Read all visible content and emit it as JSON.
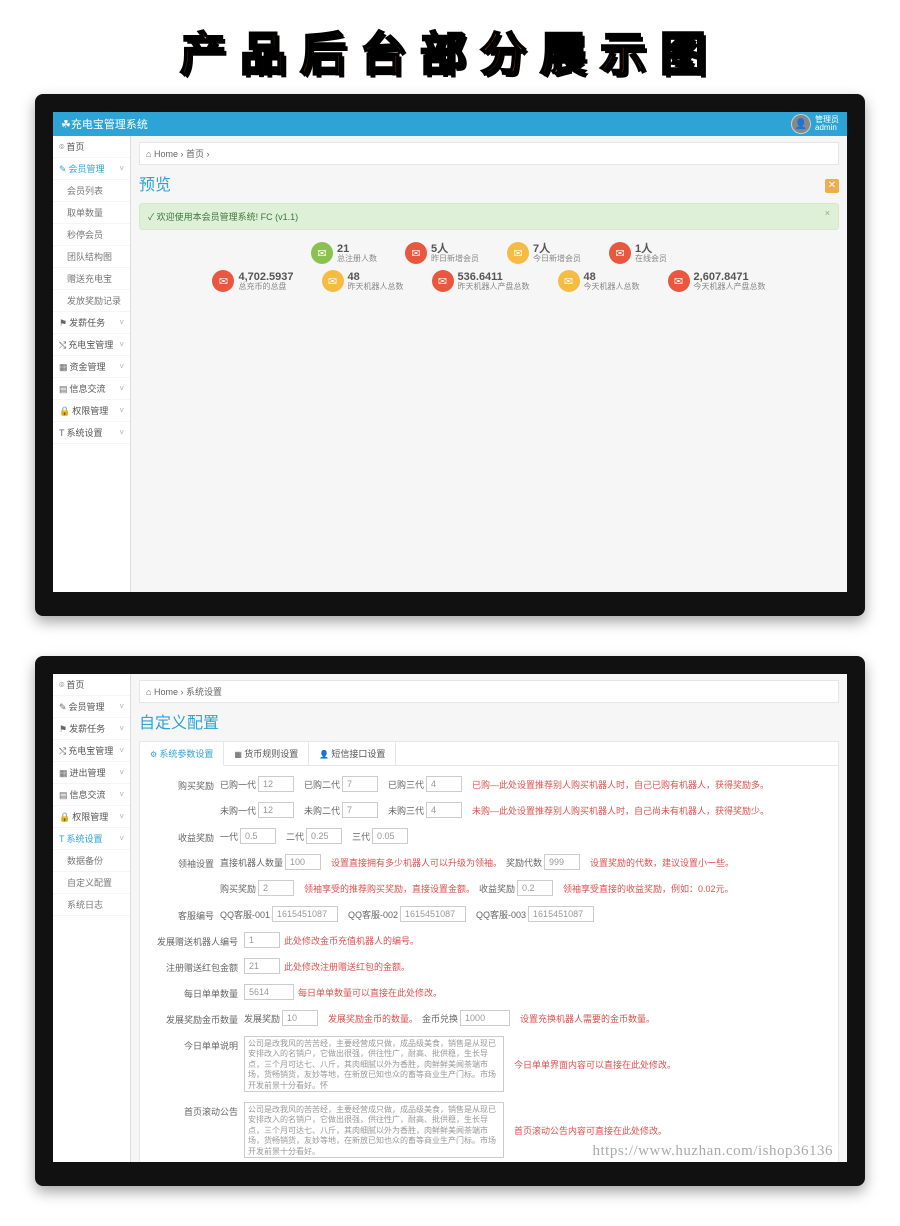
{
  "banner": "产品后台部分展示图",
  "app_title": "充电宝管理系统",
  "user": {
    "role": "管理员",
    "name": "admin"
  },
  "screen1": {
    "breadcrumb": [
      "Home",
      "首页"
    ],
    "title": "预览",
    "alert": "欢迎使用本会员管理系统! FC (v1.1)",
    "sidebar": {
      "top": "首页",
      "group1": {
        "label": "会员管理",
        "items": [
          "会员列表",
          "取单数量",
          "秒停会员",
          "团队结构图",
          "赠送充电宝",
          "发放奖励记录"
        ]
      },
      "rest": [
        "发薪任务",
        "充电宝管理",
        "资金管理",
        "信息交流",
        "权限管理",
        "系统设置"
      ]
    },
    "stats_top": [
      {
        "value": "21",
        "label": "总注册人数",
        "color": "green"
      },
      {
        "value": "5人",
        "label": "昨日新增会员",
        "color": "red"
      },
      {
        "value": "7人",
        "label": "今日新增会员",
        "color": "orange"
      },
      {
        "value": "1人",
        "label": "在线会员",
        "color": "red"
      }
    ],
    "stats_bot": [
      {
        "value": "4,702.5937",
        "label": "总充币的总盘",
        "color": "red"
      },
      {
        "value": "48",
        "label": "昨天机器人总数",
        "color": "orange"
      },
      {
        "value": "536.6411",
        "label": "昨天机器人产盘总数",
        "color": "red"
      },
      {
        "value": "48",
        "label": "今天机器人总数",
        "color": "orange"
      },
      {
        "value": "2,607.8471",
        "label": "今天机器人产盘总数",
        "color": "red"
      }
    ]
  },
  "screen2": {
    "breadcrumb": [
      "Home",
      "系统设置"
    ],
    "title": "自定义配置",
    "sidebar": {
      "top": "首页",
      "items": [
        "会员管理",
        "发薪任务",
        "充电宝管理",
        "进出管理",
        "信息交流",
        "权限管理"
      ],
      "group": {
        "label": "系统设置",
        "items": [
          "数据备份",
          "自定义配置",
          "系统日志"
        ]
      }
    },
    "tabs": [
      "系统参数设置",
      "货币规则设置",
      "短信接口设置"
    ],
    "form": {
      "buy_bonus": {
        "label": "购买奖励",
        "row1": {
          "f1l": "已购一代",
          "f1v": "12",
          "f2l": "已购二代",
          "f2v": "7",
          "f3l": "已购三代",
          "f3v": "4",
          "help": "已购—此处设置推荐别人购买机器人时，自己已购有机器人，获得奖励多。"
        },
        "row2": {
          "f1l": "未购一代",
          "f1v": "12",
          "f2l": "未购二代",
          "f2v": "7",
          "f3l": "未购三代",
          "f3v": "4",
          "help": "未购—此处设置推荐别人购买机器人时，自己尚未有机器人，获得奖励少。"
        }
      },
      "income_bonus": {
        "label": "收益奖励",
        "f1l": "一代",
        "f1v": "0.5",
        "f2l": "二代",
        "f2v": "0.25",
        "f3l": "三代",
        "f3v": "0.05"
      },
      "leader": {
        "label": "领袖设置",
        "f1l": "直接机器人数量",
        "f1v": "100",
        "h1": "设置直接拥有多少机器人可以升级为领袖。",
        "f2l": "奖励代数",
        "f2v": "999",
        "h2": "设置奖励的代数，建议设置小一些。",
        "r2f1l": "购买奖励",
        "r2f1v": "2",
        "r2h1": "领袖享受的推荐购买奖励，直接设置金额。",
        "r2f2l": "收益奖励",
        "r2f2v": "0.2",
        "r2h2": "领袖享受直接的收益奖励，例如：0.02元。"
      },
      "service": {
        "label": "客服编号",
        "f1l": "QQ客服-001",
        "f1v": "1615451087",
        "f2l": "QQ客服-002",
        "f2v": "1615451087",
        "f3l": "QQ客服-003",
        "f3v": "1615451087"
      },
      "gift_robot": {
        "label": "发展赠送机器人编号",
        "v": "1",
        "help": "此处修改金币充值机器人的编号。"
      },
      "reg_red": {
        "label": "注册赠送红包金额",
        "v": "21",
        "help": "此处修改注册赠送红包的金额。"
      },
      "daily_qty": {
        "label": "每日单单数量",
        "v": "5614",
        "help": "每日单单数量可以直接在此处修改。"
      },
      "dev_coin": {
        "label": "发展奖励金币数量",
        "f1l": "发展奖励",
        "f1v": "10",
        "h1": "发展奖励金币的数量。",
        "f2l": "金币兑换",
        "f2v": "1000",
        "h2": "设置充换机器人需要的金币数量。"
      },
      "daily_note": {
        "label": "今日单单说明",
        "text": "公司是改我风的苦苦经，主要经营成只做，成品级美食，销售是从现已安排改入的名销户，它做出很强，供往性广，耐高、批供稳，生长导点，三个月可达七、八斤，其肉细腻以外为香胜，肉鲜鲜美闻茶端市场，货畅销货，友妙等地，在新放已知也众的畜等商业生产门标。市场开发前景十分看好。怀",
        "help": "今日单单界面内容可以直接在此处修改。"
      },
      "home_notice": {
        "label": "首页滚动公告",
        "text": "公司是改我风的苦苦经，主要经营成只做，成品级美食，销售是从现已安排改入的名销户，它做出很强，供往性广，耐高、批供稳，生长导点，三个月可达七、八斤，其肉细腻以外为香胜，肉鲜鲜美闻茶端市场，货畅销货，友妙等地，在新放已知也众的畜等商业生产门标。市场开发前景十分看好。",
        "help": "首页滚动公告内容可直接在此处修改。"
      }
    },
    "watermark": "https://www.huzhan.com/ishop36136"
  }
}
